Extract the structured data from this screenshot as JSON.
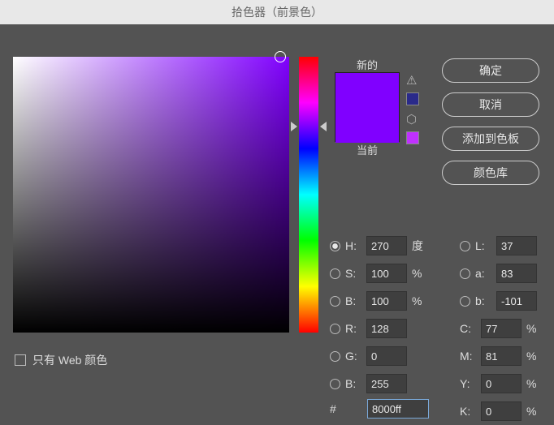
{
  "title": "拾色器（前景色）",
  "swatch": {
    "new_label": "新的",
    "current_label": "当前",
    "new_color": "#8000ff",
    "current_color": "#8000ff"
  },
  "buttons": {
    "ok": "确定",
    "cancel": "取消",
    "add_swatch": "添加到色板",
    "libraries": "颜色库"
  },
  "hsb": {
    "h": "270",
    "s": "100",
    "b": "100",
    "h_unit": "度",
    "pct": "%"
  },
  "lab": {
    "l": "37",
    "a": "83",
    "b": "-101"
  },
  "rgb": {
    "r": "128",
    "g": "0",
    "b": "255"
  },
  "cmyk": {
    "c": "77",
    "m": "81",
    "y": "0",
    "k": "0"
  },
  "labels": {
    "H": "H:",
    "S": "S:",
    "B": "B:",
    "L": "L:",
    "a": "a:",
    "b": "b:",
    "R": "R:",
    "G": "G:",
    "Bl": "B:",
    "C": "C:",
    "M": "M:",
    "Y": "Y:",
    "K": "K:",
    "hash": "#"
  },
  "hex": "8000ff",
  "web_only": "只有 Web 颜色"
}
